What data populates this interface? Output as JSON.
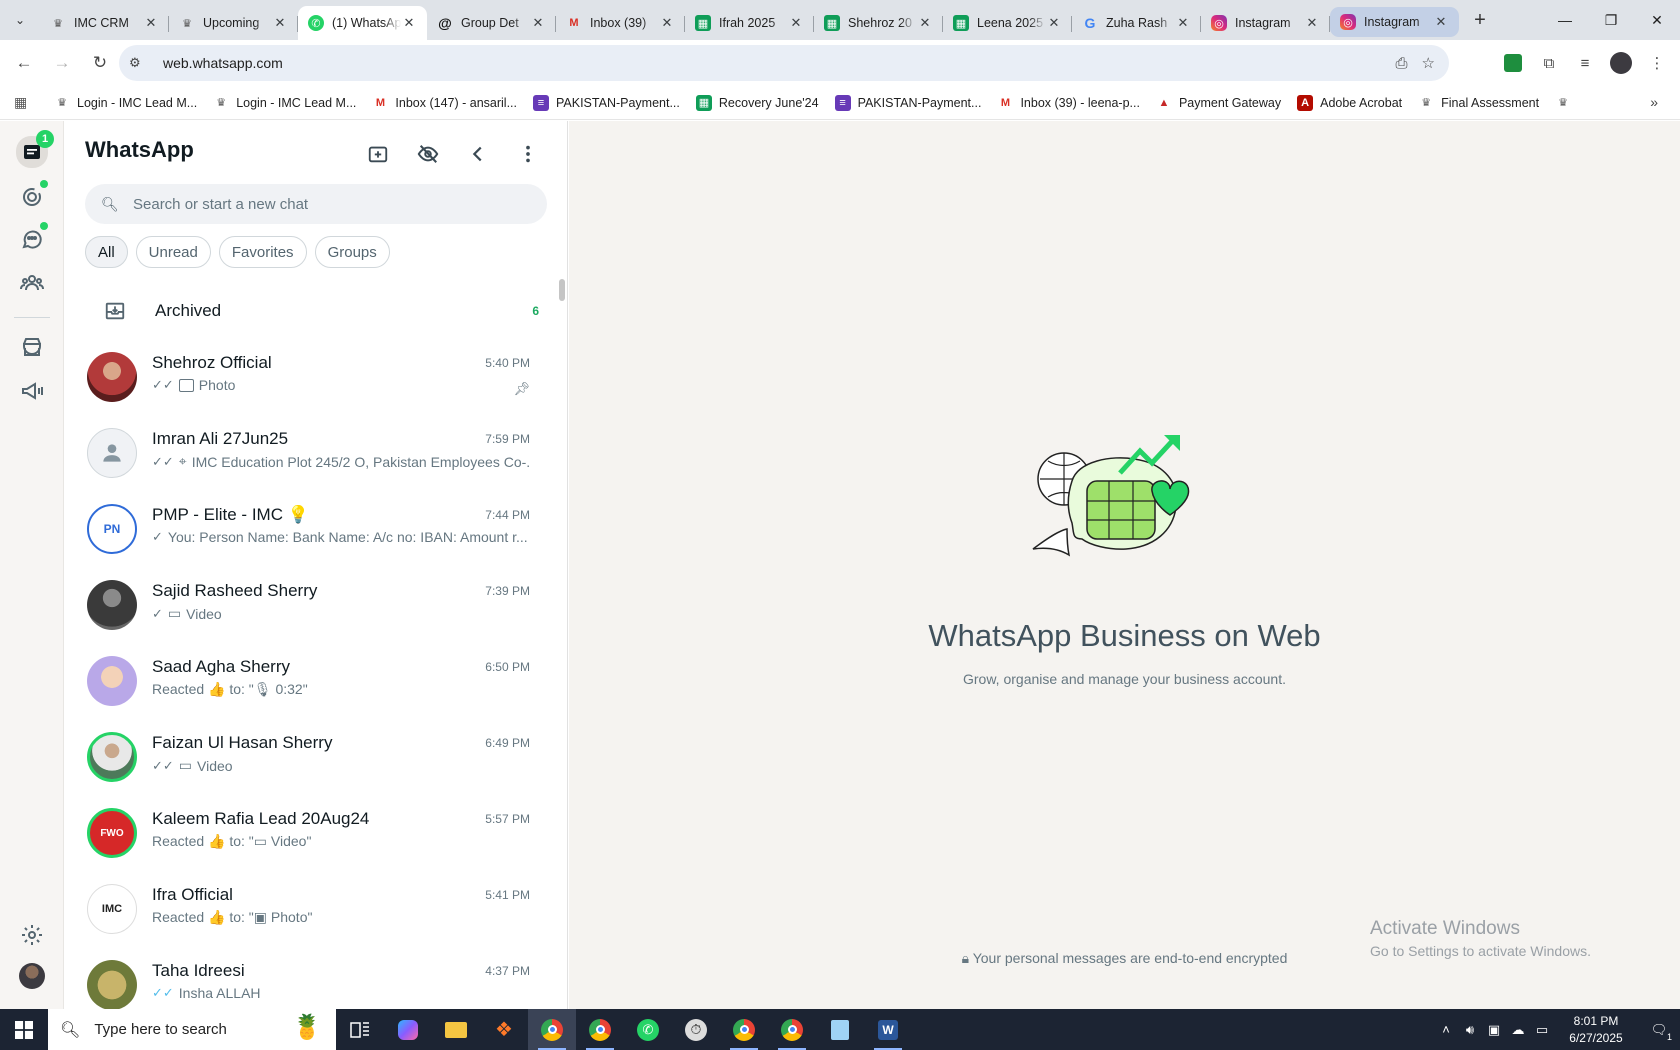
{
  "browser": {
    "tabs": [
      {
        "title": "IMC CRM",
        "icon": "imc-logo-icon"
      },
      {
        "title": "Upcoming",
        "icon": "imc-logo-icon"
      },
      {
        "title": "(1) WhatsApp",
        "icon": "whatsapp-icon"
      },
      {
        "title": "Group Det",
        "icon": "threads-icon"
      },
      {
        "title": "Inbox (39)",
        "icon": "gmail-icon"
      },
      {
        "title": "Ifrah 2025",
        "icon": "sheets-icon"
      },
      {
        "title": "Shehroz 20",
        "icon": "sheets-icon"
      },
      {
        "title": "Leena 2025",
        "icon": "sheets-icon"
      },
      {
        "title": "Zuha Rash",
        "icon": "google-icon"
      },
      {
        "title": "Instagram",
        "icon": "instagram-icon"
      },
      {
        "title": "Instagram",
        "icon": "instagram-icon"
      }
    ],
    "url": "web.whatsapp.com",
    "bookmarks": [
      {
        "label": "Login - IMC Lead M...",
        "icon": "imc-logo-icon"
      },
      {
        "label": "Login - IMC Lead M...",
        "icon": "imc-logo-icon"
      },
      {
        "label": "Inbox (147) - ansaril...",
        "icon": "gmail-icon"
      },
      {
        "label": "PAKISTAN-Payment...",
        "icon": "forms-icon"
      },
      {
        "label": "Recovery June'24",
        "icon": "sheets-icon"
      },
      {
        "label": "PAKISTAN-Payment...",
        "icon": "forms-icon"
      },
      {
        "label": "Inbox (39) - leena-p...",
        "icon": "gmail-icon"
      },
      {
        "label": "Payment Gateway",
        "icon": "gateway-icon"
      },
      {
        "label": "Adobe Acrobat",
        "icon": "acrobat-icon"
      },
      {
        "label": "Final Assessment",
        "icon": "imc-logo-icon"
      }
    ]
  },
  "whatsapp": {
    "rail": {
      "chats_badge": "1"
    },
    "title": "WhatsApp",
    "search_placeholder": "Search or start a new chat",
    "filters": [
      "All",
      "Unread",
      "Favorites",
      "Groups"
    ],
    "archived": {
      "label": "Archived",
      "count": "6"
    },
    "chats": [
      {
        "name": "Shehroz Official",
        "time": "5:40 PM",
        "preview": "Photo",
        "status": "read-gray",
        "media": "photo",
        "pinned": true
      },
      {
        "name": "Imran Ali 27Jun25",
        "time": "7:59 PM",
        "preview": "IMC Education Plot 245/2 O, Pakistan Employees Co-...",
        "status": "read-gray",
        "media": "location"
      },
      {
        "name": "PMP - Elite - IMC 💡",
        "time": "7:44 PM",
        "preview": "You: Person Name: Bank Name: A/c no: IBAN: Amount r...",
        "status": "sent"
      },
      {
        "name": "Sajid Rasheed Sherry",
        "time": "7:39 PM",
        "preview": "Video",
        "status": "sent",
        "media": "video"
      },
      {
        "name": "Saad Agha Sherry",
        "time": "6:50 PM",
        "preview": "Reacted 👍 to: \"🎙 0:32\""
      },
      {
        "name": "Faizan Ul Hasan Sherry",
        "time": "6:49 PM",
        "preview": "Video",
        "status": "read-gray",
        "media": "video"
      },
      {
        "name": "Kaleem Rafia Lead 20Aug24",
        "time": "5:57 PM",
        "preview": "Reacted 👍 to: \"▭ Video\""
      },
      {
        "name": "Ifra Official",
        "time": "5:41 PM",
        "preview": "Reacted 👍 to: \"▣ Photo\""
      },
      {
        "name": "Taha Idreesi",
        "time": "4:37 PM",
        "preview": "Insha ALLAH",
        "status": "read-blue"
      }
    ],
    "pane": {
      "title": "WhatsApp Business on Web",
      "subtitle": "Grow, organise and manage your business account.",
      "encryption": "Your personal messages are end-to-end encrypted"
    }
  },
  "watermark": {
    "line1": "Activate Windows",
    "line2": "Go to Settings to activate Windows."
  },
  "taskbar": {
    "search_placeholder": "Type here to search",
    "time": "8:01 PM",
    "date": "6/27/2025",
    "notifications": "1"
  }
}
